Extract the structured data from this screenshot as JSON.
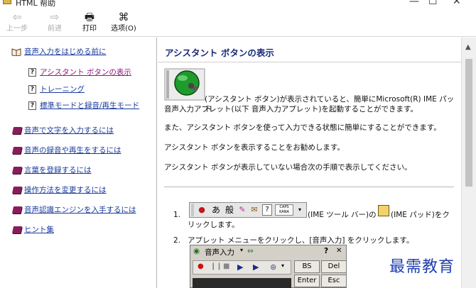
{
  "window": {
    "title": "HTML 帮助",
    "controls": [
      "—",
      "☐",
      "✕"
    ]
  },
  "toolbar": {
    "back": {
      "label": "上一步",
      "icon": "⇦"
    },
    "forward": {
      "label": "前进",
      "icon": "⇨"
    },
    "print": {
      "label": "打印",
      "icon": "🖶"
    },
    "options": {
      "label": "选项(O)",
      "icon": "⌘"
    }
  },
  "nav": {
    "book_intro": "音声入力をはじめる前に",
    "page_show": "アシスタント ボタンの表示",
    "page_training": "トレーニング",
    "page_mode": "標準モードと録音/再生モード",
    "book_input": "音声で文字を入力するには",
    "book_record": "音声の録音や再生をするには",
    "book_words": "言葉を登録するには",
    "book_settings": "操作方法を変更するには",
    "book_engine": "音声認識エンジンを入手するには",
    "book_tips": "ヒント集"
  },
  "content": {
    "title": "アシスタント ボタンの表示",
    "p1_line1": "(アシスタント ボタン)が表示されていると、簡単にMicrosoft(R) IME パッド",
    "p1_line2": "音声入力アプレット(以下 音声入力アプレット)を起動することができます。",
    "p2": "また、アシスタント ボタンを使って入力できる状態に簡単にすることができます。",
    "p3": "アシスタント ボタンを表示することをお勧めします。",
    "p4": "アシスタント ボタンが表示していない場合次の手順で表示してください。",
    "step1_num": "1.",
    "step1_a": "(IME ツール バー)の",
    "step1_b": "(IME パッド)をク",
    "step1_c": "リックします。",
    "step2_num": "2.",
    "step2": "アプレット メニューをクリックし、[音声入力] をクリックします。"
  },
  "langbar": {
    "hira": "あ",
    "mode": "般",
    "caps": "CAPS",
    "kana": "KANA"
  },
  "palette": {
    "title": "音声入力",
    "help": "?",
    "close": "✕",
    "bs": "BS",
    "del": "Del",
    "enter": "Enter",
    "esc": "Esc"
  },
  "watermark": "最需教育"
}
